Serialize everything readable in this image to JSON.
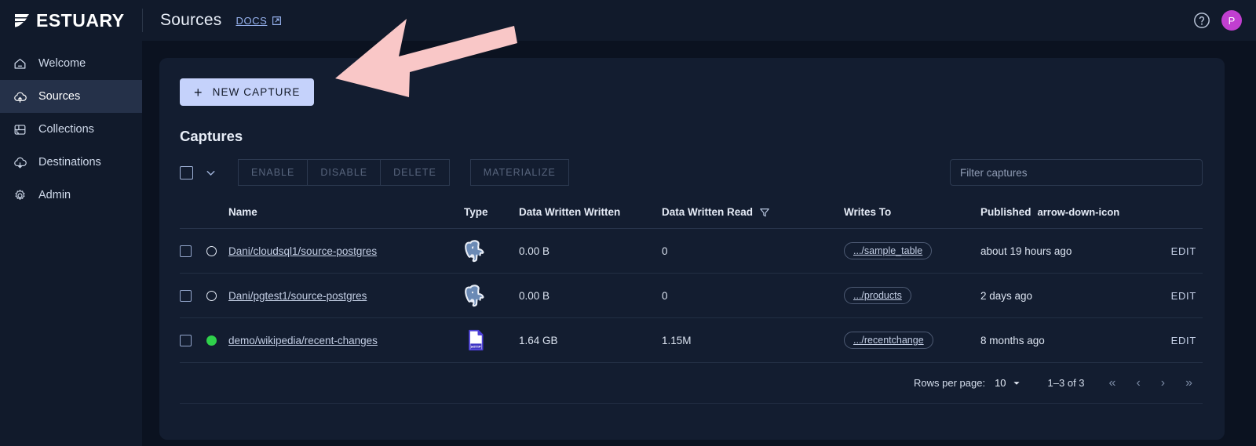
{
  "topbar": {
    "logo_text": "ESTUARY",
    "logo_icon": "estuary-logo-icon",
    "page_title": "Sources",
    "docs_label": "DOCS",
    "docs_icon": "external-link-icon",
    "help_icon": "help-circle-icon",
    "avatar_initial": "P",
    "avatar_color": "#c13fd0"
  },
  "sidebar": {
    "items": [
      {
        "label": "Welcome",
        "icon": "home-icon",
        "active": false
      },
      {
        "label": "Sources",
        "icon": "cloud-upload-icon",
        "active": true
      },
      {
        "label": "Collections",
        "icon": "collections-icon",
        "active": false
      },
      {
        "label": "Destinations",
        "icon": "cloud-download-icon",
        "active": false
      },
      {
        "label": "Admin",
        "icon": "gear-icon",
        "active": false
      }
    ]
  },
  "main": {
    "new_capture_label": "NEW CAPTURE",
    "new_capture_icon": "plus-icon",
    "section_title": "Captures",
    "toolbar": {
      "select_all_icon": "checkbox-icon",
      "select_menu_icon": "chevron-down-icon",
      "buttons": [
        "ENABLE",
        "DISABLE",
        "DELETE",
        "MATERIALIZE"
      ],
      "filter_placeholder": "Filter captures"
    },
    "table": {
      "columns": [
        "Name",
        "Type",
        "Data Written Written",
        "Data Written Read",
        "Writes To",
        "Published"
      ],
      "filter_icon": "filter-icon",
      "sort_icon": "arrow-down-icon",
      "edit_label": "EDIT",
      "rows": [
        {
          "name": "Dani/cloudsql1/source-postgres",
          "status": "hollow",
          "type_icon": "postgres-icon",
          "data_written_written": "0.00 B",
          "data_written_read": "0",
          "writes_to": ".../sample_table",
          "published": "about 19 hours ago",
          "edit": "EDIT"
        },
        {
          "name": "Dani/pgtest1/source-postgres",
          "status": "hollow",
          "type_icon": "postgres-icon",
          "data_written_written": "0.00 B",
          "data_written_read": "0",
          "writes_to": ".../products",
          "published": "2 days ago",
          "edit": "EDIT"
        },
        {
          "name": "demo/wikipedia/recent-changes",
          "status": "green",
          "type_icon": "http-file-icon",
          "data_written_written": "1.64 GB",
          "data_written_read": "1.15M",
          "writes_to": ".../recentchange",
          "published": "8 months ago",
          "edit": "EDIT"
        }
      ]
    },
    "pagination": {
      "rows_per_page_label": "Rows per page:",
      "rows_per_page_value": "10",
      "range_label": "1–3 of 3",
      "first_icon": "«",
      "prev_icon": "‹",
      "next_icon": "›",
      "last_icon": "»"
    }
  },
  "annotation": {
    "arrow_color": "#f9c7c7",
    "arrow_name": "annotation-arrow"
  }
}
